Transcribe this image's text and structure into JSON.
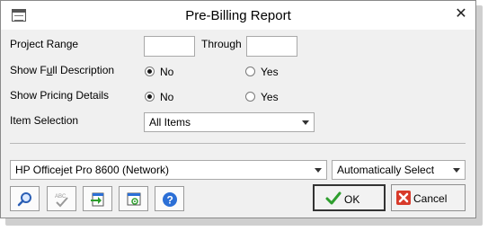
{
  "window": {
    "title": "Pre-Billing Report",
    "close_glyph": "✕"
  },
  "project_range": {
    "label": "Project Range",
    "from_value": "",
    "through_label": "Through",
    "to_value": ""
  },
  "full_description": {
    "label_pre": "Show F",
    "label_u": "u",
    "label_post": "ll Description",
    "selected": "No",
    "options": [
      "No",
      "Yes"
    ]
  },
  "pricing_details": {
    "label": "Show Pricing Details",
    "selected": "No",
    "options": [
      "No",
      "Yes"
    ]
  },
  "item_selection": {
    "label": "Item Selection",
    "value": "All Items"
  },
  "printer": {
    "value": "HP Officejet Pro 8600 (Network)"
  },
  "tray": {
    "value": "Automatically Select"
  },
  "toolbar": {
    "icons": [
      "search-icon",
      "spellcheck-icon",
      "export-icon",
      "print-setup-icon",
      "help-icon"
    ]
  },
  "actions": {
    "ok_label": "OK",
    "cancel_label": "Cancel"
  },
  "colors": {
    "help_blue": "#2b6fd6",
    "ok_green": "#2e9e2e",
    "cancel_red": "#d83a2a"
  }
}
